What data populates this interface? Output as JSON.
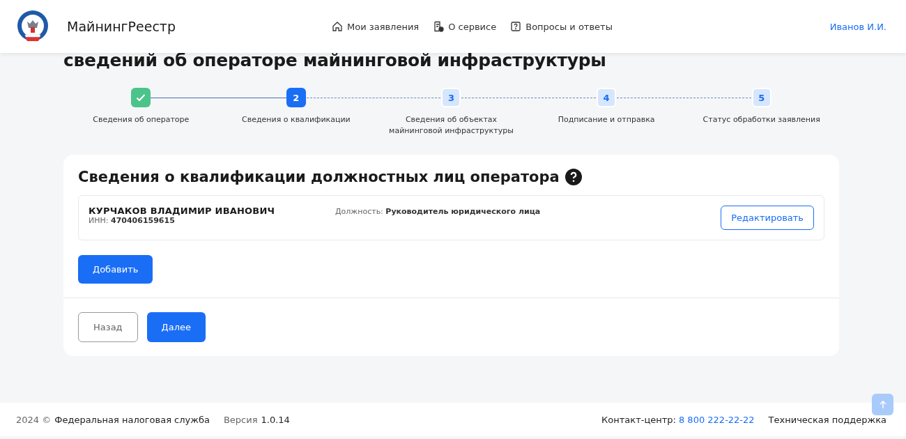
{
  "header": {
    "brand": "МайнингРеестр",
    "nav": [
      {
        "label": "Мои заявления",
        "kind": "home"
      },
      {
        "label": "О сервисе",
        "kind": "doc"
      },
      {
        "label": "Вопросы и ответы",
        "kind": "question"
      }
    ],
    "user": "Иванов И.И."
  },
  "page_title": "сведений об операторе майнинговой инфраструктуры",
  "steps": [
    {
      "kind": "done",
      "label": "Сведения об операторе"
    },
    {
      "kind": "current",
      "number": "2",
      "label": "Сведения о квалификации"
    },
    {
      "kind": "pending",
      "number": "3",
      "label": "Сведения об объектах майнинговой инфраструктуры"
    },
    {
      "kind": "pending",
      "number": "4",
      "label": "Подписание и отправка"
    },
    {
      "kind": "pending",
      "number": "5",
      "label": "Статус обработки заявления"
    }
  ],
  "section": {
    "title": "Сведения о квалификации должностных лиц оператора",
    "persons": [
      {
        "name": "КУРЧАКОВ ВЛАДИМИР ИВАНОВИЧ",
        "inn": "ИНН: **470406159615**",
        "position": "Должность: **Руководитель юридического лица**",
        "edit_button": "Редактировать"
      }
    ],
    "add_button": "Добавить",
    "back_button": "Назад",
    "next_button": "Далее"
  },
  "footer": {
    "year": "2024 ©",
    "org": "Федеральная налоговая служба",
    "version_label": "Версия",
    "version": "1.0.14",
    "contact_label": "Контакт-центр:",
    "phone": "8 800 222-22-22",
    "support": "Техническая поддержка"
  }
}
